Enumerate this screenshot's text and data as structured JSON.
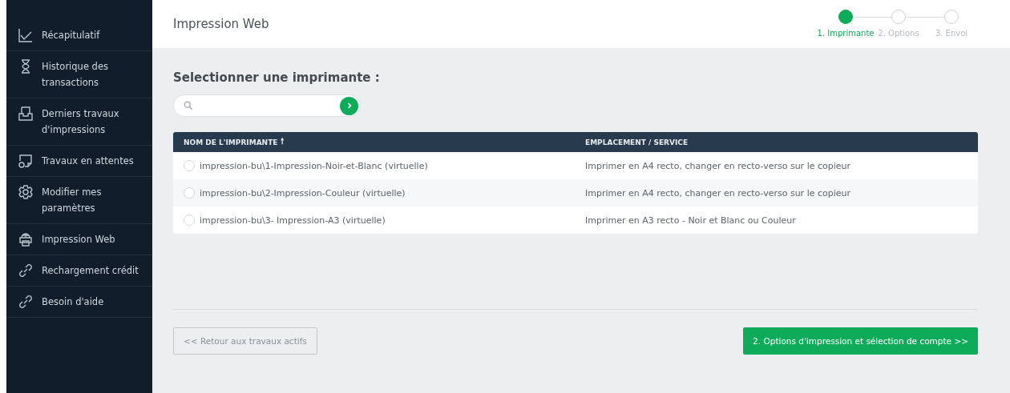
{
  "sidebar": {
    "items": [
      {
        "label": "Récapitulatif"
      },
      {
        "label": "Historique des transactions"
      },
      {
        "label": "Derniers travaux d'impressions"
      },
      {
        "label": "Travaux en attentes"
      },
      {
        "label": "Modifier mes paramètres"
      },
      {
        "label": "Impression Web"
      },
      {
        "label": "Rechargement crédit"
      },
      {
        "label": "Besoin d'aide"
      }
    ]
  },
  "header": {
    "title": "Impression Web",
    "steps": [
      {
        "label": "1. Imprimante",
        "selected": true
      },
      {
        "label": "2. Options",
        "selected": false
      },
      {
        "label": "3. Envoi",
        "selected": false
      }
    ]
  },
  "heading": "Selectionner une imprimante :",
  "table": {
    "columns": [
      "NOM DE L'IMPRIMANTE",
      "EMPLACEMENT / SERVICE"
    ],
    "sort_icon": "🠕",
    "rows": [
      {
        "name": "impression-bu\\1-Impression-Noir-et-Blanc (virtuelle)",
        "location": "Imprimer en A4 recto, changer en recto-verso sur le copieur",
        "selected": false
      },
      {
        "name": "impression-bu\\2-Impression-Couleur (virtuelle)",
        "location": "Imprimer en A4 recto, changer en recto-verso sur le copieur",
        "selected": false
      },
      {
        "name": "impression-bu\\3- Impression-A3 (virtuelle)",
        "location": "Imprimer en A3 recto - Noir et Blanc ou Couleur",
        "selected": false
      }
    ]
  },
  "buttons": {
    "back": "<< Retour aux travaux actifs",
    "next": "2. Options d'impression et sélection de compte >>"
  }
}
